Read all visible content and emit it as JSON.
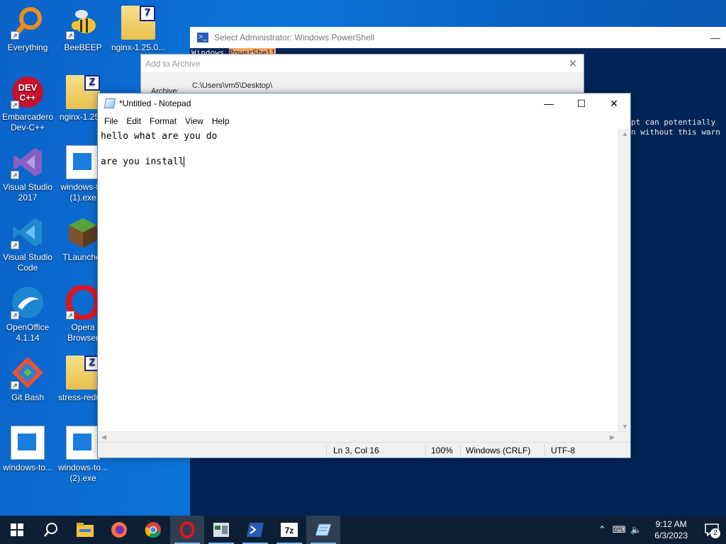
{
  "desktop": {
    "icons": [
      {
        "label": "Everything",
        "icon": "everything-icon"
      },
      {
        "label": "BeeBEEP",
        "icon": "beebeep-icon"
      },
      {
        "label": "nginx-1.25.0...",
        "icon": "7z-archive-icon"
      },
      {
        "label": "Embarcadero Dev-C++",
        "icon": "devcpp-icon"
      },
      {
        "label": "nginx-1.25...",
        "icon": "zip-archive-icon"
      },
      {
        "label": "Visual Studio 2017",
        "icon": "visual-studio-icon"
      },
      {
        "label": "windows-t... (1).exe",
        "icon": "exe-icon"
      },
      {
        "label": "Visual Studio Code",
        "icon": "vscode-icon"
      },
      {
        "label": "TLauncher",
        "icon": "tlauncher-icon"
      },
      {
        "label": "OpenOffice 4.1.14",
        "icon": "openoffice-icon"
      },
      {
        "label": "Opera Browser",
        "icon": "opera-icon"
      },
      {
        "label": "Git Bash",
        "icon": "git-bash-icon"
      },
      {
        "label": "stress-redu...",
        "icon": "zip-archive-icon"
      },
      {
        "label": "windows-to...",
        "icon": "exe-icon"
      },
      {
        "label": "windows-to... (2).exe",
        "icon": "exe-icon"
      }
    ]
  },
  "powershell": {
    "title": "Select Administrator: Windows PowerShell",
    "line1a": "Windows ",
    "line1b": "PowerShell",
    "line2": "pt can potentially",
    "line3": "n without this warn"
  },
  "archive": {
    "title": "Add to Archive",
    "archive_label": "Archive:",
    "path": "C:\\Users\\vm5\\Desktop\\"
  },
  "notepad": {
    "title": "*Untitled - Notepad",
    "menu": [
      "File",
      "Edit",
      "Format",
      "View",
      "Help"
    ],
    "lines": [
      "hello what are you do",
      "",
      "are you install"
    ],
    "status": {
      "position": "Ln 3, Col 16",
      "zoom": "100%",
      "line_ending": "Windows (CRLF)",
      "encoding": "UTF-8"
    }
  },
  "taskbar": {
    "apps": [
      "start",
      "search",
      "file-explorer",
      "firefox",
      "chrome",
      "opera",
      "archive-app",
      "powershell",
      "7zip",
      "notepad"
    ],
    "clock_time": "9:12 AM",
    "clock_date": "6/3/2023",
    "notification_count": "2"
  }
}
